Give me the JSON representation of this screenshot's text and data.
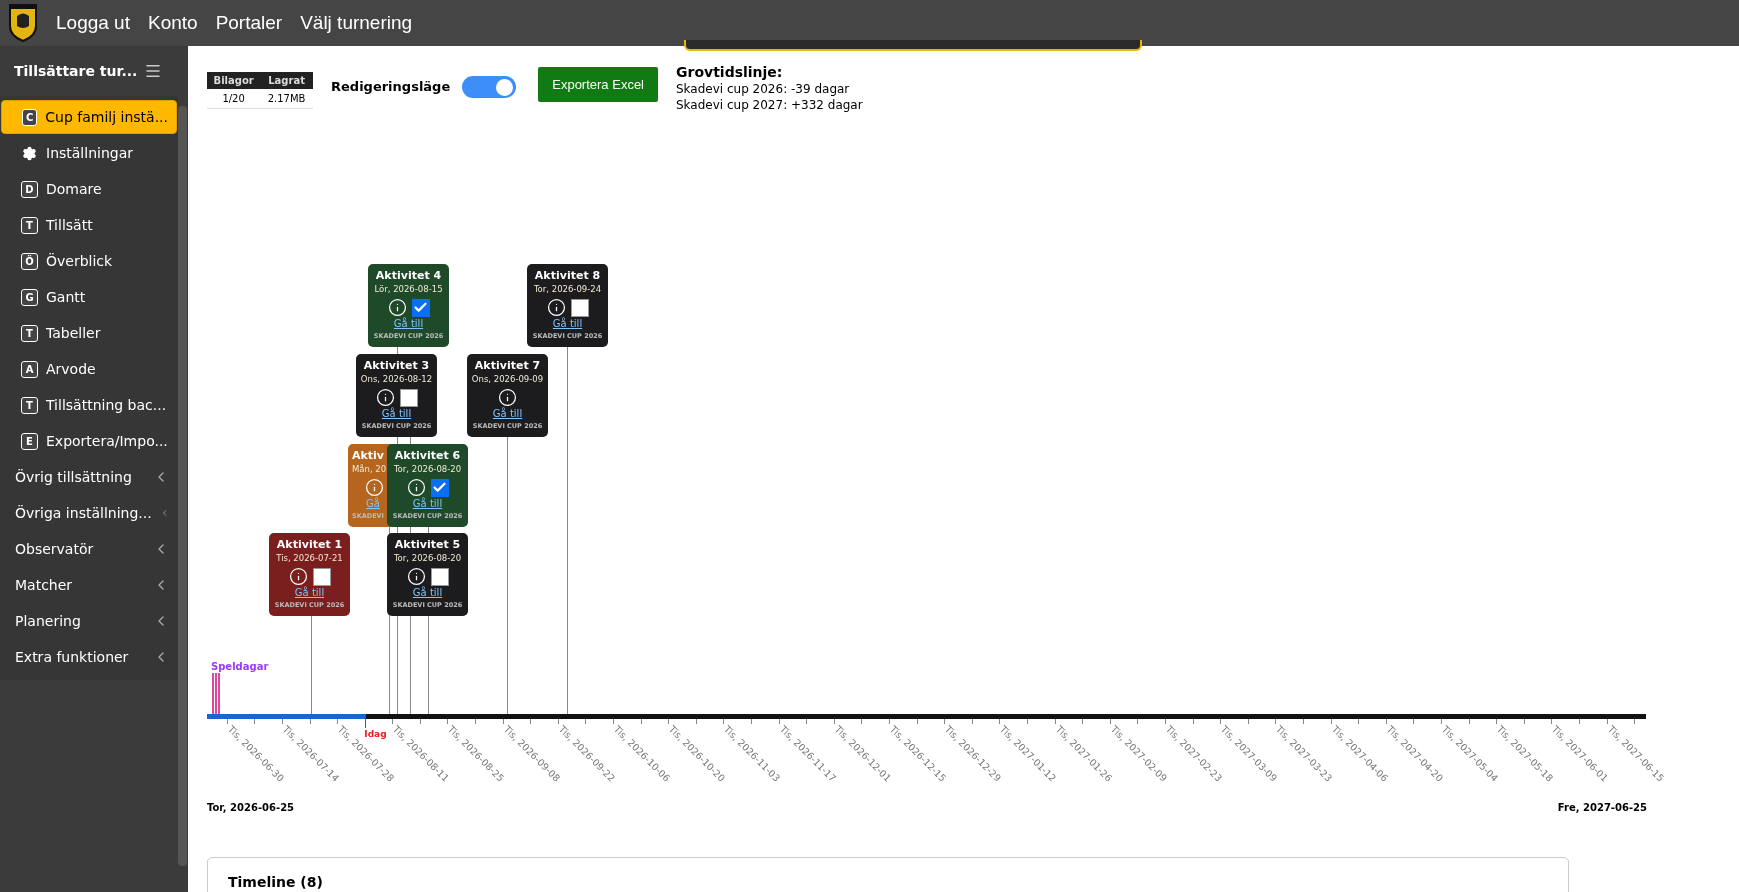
{
  "header": {
    "nav": [
      "Logga ut",
      "Konto",
      "Portaler",
      "Välj turnering"
    ]
  },
  "sidebar": {
    "title": "Tillsättare tur...",
    "items": [
      {
        "kind": "letter",
        "badge": "C",
        "label": "Cup familj instä...",
        "selected": true
      },
      {
        "kind": "gear",
        "label": "Inställningar",
        "selected": false
      },
      {
        "kind": "letter",
        "badge": "D",
        "label": "Domare",
        "selected": false
      },
      {
        "kind": "letter",
        "badge": "T",
        "label": "Tillsätt",
        "selected": false
      },
      {
        "kind": "letter",
        "badge": "Ö",
        "label": "Överblick",
        "selected": false
      },
      {
        "kind": "letter",
        "badge": "G",
        "label": "Gantt",
        "selected": false
      },
      {
        "kind": "letter",
        "badge": "T",
        "label": "Tabeller",
        "selected": false
      },
      {
        "kind": "letter",
        "badge": "A",
        "label": "Arvode",
        "selected": false
      },
      {
        "kind": "letter",
        "badge": "T",
        "label": "Tillsättning bac...",
        "selected": false
      },
      {
        "kind": "letter",
        "badge": "E",
        "label": "Exportera/Impo...",
        "selected": false
      },
      {
        "kind": "group",
        "label": "Övrig tillsättning",
        "selected": false
      },
      {
        "kind": "group",
        "label": "Övriga inställning...",
        "selected": false
      },
      {
        "kind": "group",
        "label": "Observatör",
        "selected": false
      },
      {
        "kind": "group",
        "label": "Matcher",
        "selected": false
      },
      {
        "kind": "group",
        "label": "Planering",
        "selected": false
      },
      {
        "kind": "group",
        "label": "Extra funktioner",
        "selected": false
      }
    ]
  },
  "toolbar": {
    "storage": {
      "columns": [
        "Bilagor",
        "Lagrat"
      ],
      "values": [
        "1/20",
        "2.17MB"
      ]
    },
    "edit_mode": {
      "label": "Redigeringsläge",
      "on": true
    },
    "export_button": "Exportera Excel",
    "rough_timeline": {
      "title": "Grovtidslinje:",
      "lines": [
        "Skadevi cup 2026: -39 dagar",
        "Skadevi cup 2027: +332 dagar"
      ]
    }
  },
  "timeline": {
    "play_days_label": "Speldagar",
    "today_label": "Idag",
    "elapsed": {
      "level": 0.11
    },
    "start_label": "Tor, 2026-06-25",
    "end_label": "Fre, 2027-06-25",
    "ticks": [
      "Tis, 2026-06-30",
      "Tis, 2026-07-14",
      "Tis, 2026-07-28",
      "Tis, 2026-08-11",
      "Tis, 2026-08-25",
      "Tis, 2026-09-08",
      "Tis, 2026-09-22",
      "Tis, 2026-10-06",
      "Tis, 2026-10-20",
      "Tis, 2026-11-03",
      "Tis, 2026-11-17",
      "Tis, 2026-12-01",
      "Tis, 2026-12-15",
      "Tis, 2026-12-29",
      "Tis, 2027-01-12",
      "Tis, 2027-01-26",
      "Tis, 2027-02-09",
      "Tis, 2027-02-23",
      "Tis, 2027-03-09",
      "Tis, 2027-03-23",
      "Tis, 2027-04-06",
      "Tis, 2027-04-20",
      "Tis, 2027-05-04",
      "Tis, 2027-05-18",
      "Tis, 2027-06-01",
      "Tis, 2027-06-15"
    ],
    "activities": [
      {
        "title": "Aktivitet 4",
        "date": "Lör, 2026-08-15",
        "link": "Gå till",
        "footer": "SKADEVI CUP 2026",
        "color": "#1f4a2a",
        "has_checkbox": true,
        "checked": true
      },
      {
        "title": "Aktivitet 8",
        "date": "Tor, 2026-09-24",
        "link": "Gå till",
        "footer": "SKADEVI CUP 2026",
        "color": "#1c1c1e",
        "has_checkbox": true,
        "checked": false
      },
      {
        "title": "Aktivitet 3",
        "date": "Ons, 2026-08-12",
        "link": "Gå till",
        "footer": "SKADEVI CUP 2026",
        "color": "#1c1c1e",
        "has_checkbox": true,
        "checked": false
      },
      {
        "title": "Aktivitet 7",
        "date": "Ons, 2026-09-09",
        "link": "Gå till",
        "footer": "SKADEVI CUP 2026",
        "color": "#1c1c1e",
        "has_checkbox": false
      },
      {
        "title": "Aktiv",
        "date": "Mån, 20",
        "link": "Gå",
        "footer": "SKADEVI",
        "color": "#b5651d"
      },
      {
        "title": "Aktivitet 6",
        "date": "Tor, 2026-08-20",
        "link": "Gå till",
        "footer": "SKADEVI CUP 2026",
        "color": "#1f4a2a",
        "has_checkbox": true,
        "checked": true
      },
      {
        "title": "Aktivitet 1",
        "date": "Tis, 2026-07-21",
        "link": "Gå till",
        "footer": "SKADEVI CUP 2026",
        "color": "#7a1e1e",
        "has_checkbox": true,
        "checked": false
      },
      {
        "title": "Aktivitet 5",
        "date": "Tor, 2026-08-20",
        "link": "Gå till",
        "footer": "SKADEVI CUP 2026",
        "color": "#1c1c1e",
        "has_checkbox": true,
        "checked": false
      }
    ]
  },
  "panel": {
    "title": "Timeline (8)"
  }
}
